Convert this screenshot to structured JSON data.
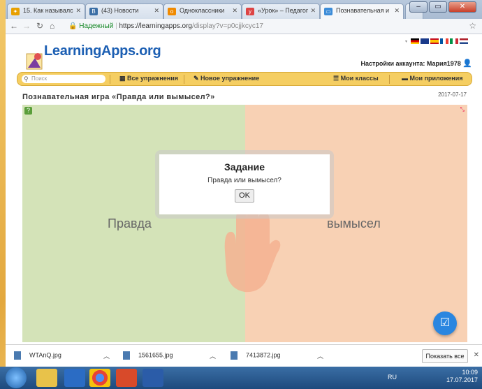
{
  "tabs": [
    {
      "label": "15. Как называлс",
      "icon": "bird-icon",
      "color": "#e8a000"
    },
    {
      "label": "(43) Новости",
      "icon": "vk-icon",
      "color": "#3a6ea5"
    },
    {
      "label": "Одноклассники",
      "icon": "ok-icon",
      "color": "#f08a00"
    },
    {
      "label": "«Урок» – Педагог",
      "icon": "urok-icon",
      "color": "#d44"
    },
    {
      "label": "Познавательная и",
      "icon": "learningapps-icon",
      "color": "#3c8cd8"
    }
  ],
  "address": {
    "secure_label": "Надежный",
    "url_host": "https://learningapps.org",
    "url_path": "/display?v=p0cjjkcyc17"
  },
  "site": {
    "logo": "LearningApps.org",
    "account": "Настройки аккаунта: Мария1978",
    "search_placeholder": "Поиск",
    "menu": [
      "Все упражнения",
      "Новое упражнение",
      "Мои классы",
      "Мои приложения"
    ]
  },
  "exercise": {
    "title": "Познавательная игра «Правда или вымысел?»",
    "date": "2017-07-17",
    "left_label": "Правда",
    "right_label": "вымысел",
    "dialog_title": "Задание",
    "dialog_text": "Правда или вымысел?",
    "ok_label": "OK"
  },
  "downloads": {
    "files": [
      "WTAnQ.jpg",
      "1561655.jpg",
      "7413872.jpg"
    ],
    "show_all": "Показать все"
  },
  "taskbar": {
    "lang": "RU",
    "time": "10:09",
    "date": "17.07.2017"
  },
  "colors": {
    "true_bg": "#d4e3b8",
    "false_bg": "#f8d1b4",
    "menu_bar": "#f5ce62",
    "fab": "#2a86e0"
  }
}
